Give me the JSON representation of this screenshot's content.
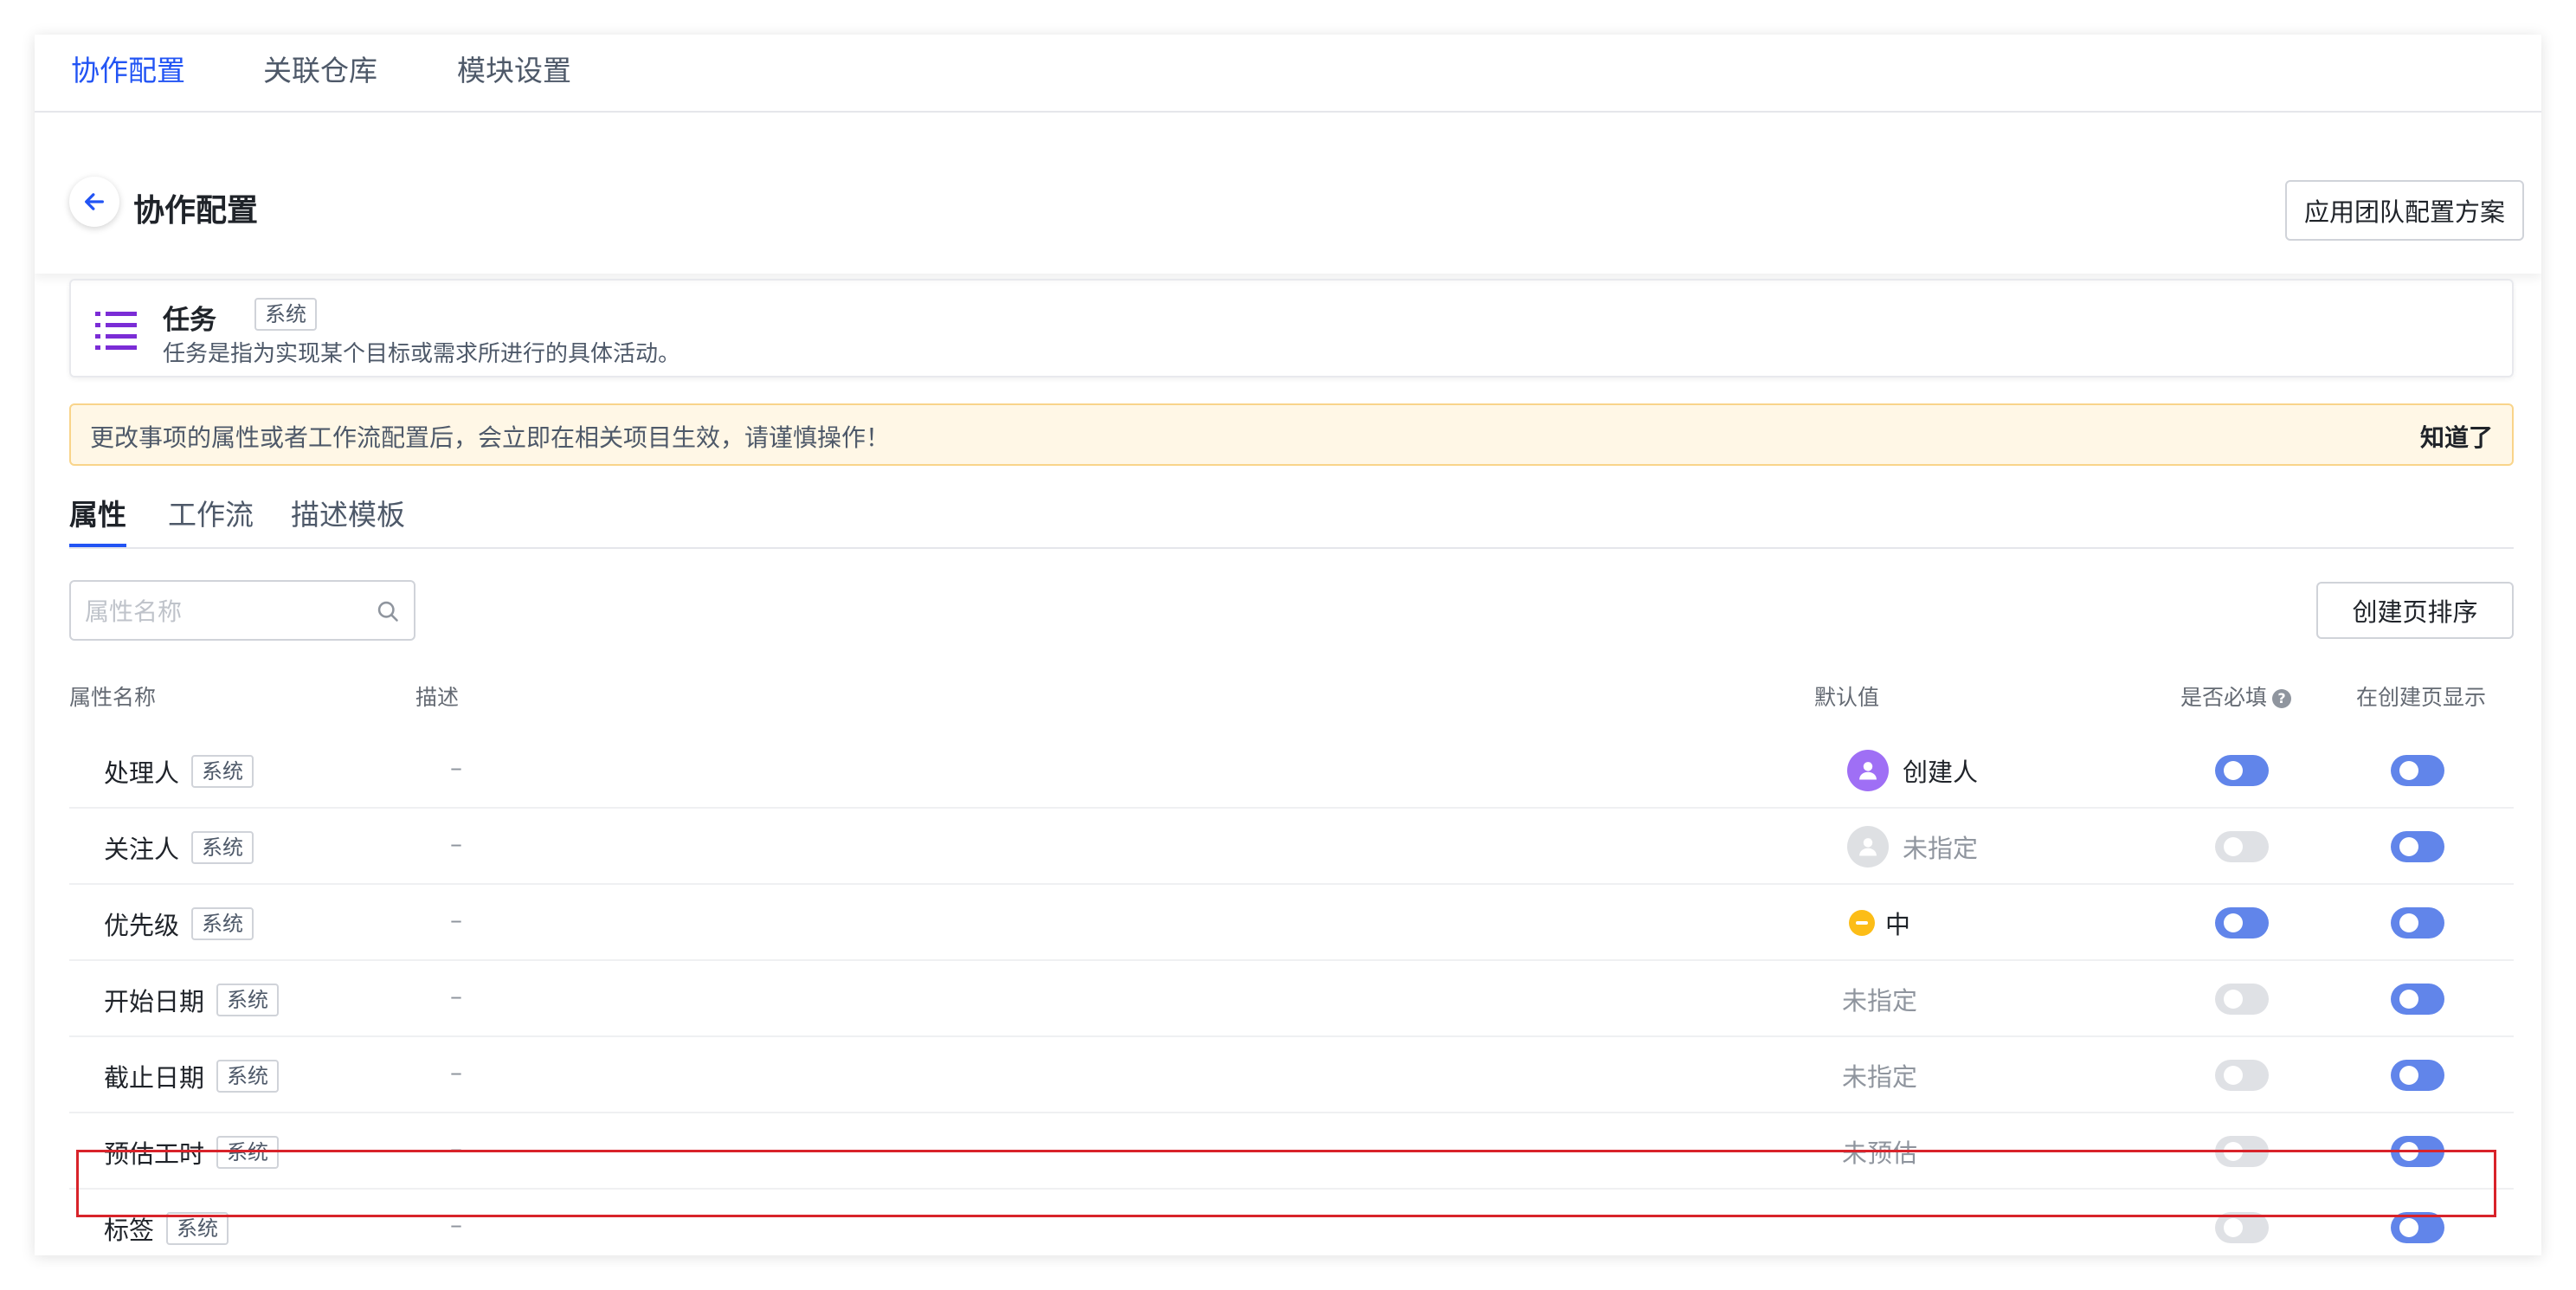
{
  "top_tabs": [
    {
      "label": "协作配置",
      "active": true
    },
    {
      "label": "关联仓库",
      "active": false
    },
    {
      "label": "模块设置",
      "active": false
    }
  ],
  "header": {
    "title": "协作配置",
    "apply_button": "应用团队配置方案"
  },
  "task": {
    "name": "任务",
    "tag": "系统",
    "description": "任务是指为实现某个目标或需求所进行的具体活动。",
    "icon": "list-icon"
  },
  "alert": {
    "text": "更改事项的属性或者工作流配置后，会立即在相关项目生效，请谨慎操作！",
    "dismiss": "知道了"
  },
  "sub_tabs": [
    {
      "label": "属性",
      "active": true
    },
    {
      "label": "工作流",
      "active": false
    },
    {
      "label": "描述模板",
      "active": false
    }
  ],
  "search": {
    "placeholder": "属性名称"
  },
  "sort_button": "创建页排序",
  "table": {
    "headers": {
      "name": "属性名称",
      "desc": "描述",
      "default": "默认值",
      "required": "是否必填",
      "show_on_create": "在创建页显示"
    },
    "rows": [
      {
        "name": "处理人",
        "tag": "系统",
        "desc": "–",
        "default": "创建人",
        "required": true,
        "show": true
      },
      {
        "name": "关注人",
        "tag": "系统",
        "desc": "–",
        "default": "未指定",
        "required": false,
        "show": true
      },
      {
        "name": "优先级",
        "tag": "系统",
        "desc": "–",
        "default": "中",
        "required": true,
        "show": true
      },
      {
        "name": "开始日期",
        "tag": "系统",
        "desc": "–",
        "default": "未指定",
        "required": false,
        "show": true
      },
      {
        "name": "截止日期",
        "tag": "系统",
        "desc": "–",
        "default": "未指定",
        "required": false,
        "show": true
      },
      {
        "name": "预估工时",
        "tag": "系统",
        "desc": "–",
        "default": "未预估",
        "required": false,
        "show": true,
        "highlighted": true
      },
      {
        "name": "标签",
        "tag": "系统",
        "desc": "–",
        "default": "",
        "required": false,
        "show": true
      }
    ]
  },
  "colors": {
    "accent": "#2254f4",
    "toggle_on": "#6185ea",
    "toggle_off": "#dfe1e5",
    "task_icon": "#7b2cd6",
    "highlight": "#d8232a"
  }
}
